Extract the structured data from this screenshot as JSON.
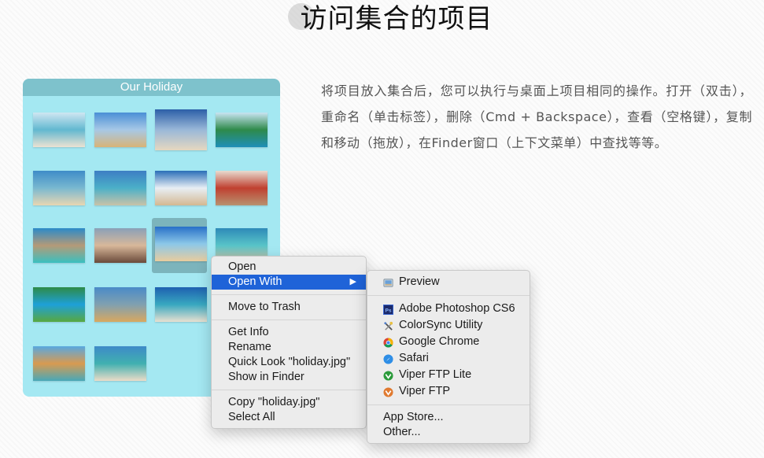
{
  "page": {
    "title": "访问集合的项目",
    "description": "将项目放入集合后，您可以执行与桌面上项目相同的操作。打开（双击），重命名（单击标签），删除（Cmd + Backspace），查看（空格键），复制和移动（拖放），在Finder窗口（上下文菜单）中查找等等。"
  },
  "collection": {
    "title": "Our Holiday",
    "selected_photo": "holiday.jpg",
    "photos": [
      {
        "name": "beach-chair-man",
        "colors": [
          "#cfe6f2",
          "#62b8d0",
          "#ece2d2"
        ]
      },
      {
        "name": "coconut-flipflops",
        "colors": [
          "#4a8fd6",
          "#a7c8e6",
          "#d8b478"
        ]
      },
      {
        "name": "friends-on-beach",
        "colors": [
          "#2b5fa8",
          "#9ab8d8",
          "#e6d8c0"
        ]
      },
      {
        "name": "green-island-bay",
        "colors": [
          "#c8e4f2",
          "#2e8a4a",
          "#1e8fb8"
        ]
      },
      {
        "name": "palm-beach-city",
        "colors": [
          "#3f8cc8",
          "#79b8d0",
          "#e8d6b2"
        ]
      },
      {
        "name": "coast-aerial",
        "colors": [
          "#3d7ec4",
          "#4bb0c8",
          "#c9c2a8"
        ]
      },
      {
        "name": "deck-chairs-beach",
        "colors": [
          "#2a6eb8",
          "#e8eef4",
          "#d4b892"
        ]
      },
      {
        "name": "woman-selfie-street",
        "colors": [
          "#e8dcd0",
          "#c04030",
          "#b89270"
        ]
      },
      {
        "name": "turquoise-bay",
        "colors": [
          "#2c8ac8",
          "#b49a78",
          "#3ac0c0"
        ]
      },
      {
        "name": "promenade-beach",
        "colors": [
          "#8aa0b8",
          "#d8b89a",
          "#6a4a3a"
        ]
      },
      {
        "name": "holiday.jpg",
        "colors": [
          "#2870c8",
          "#8cc8e8",
          "#e8cc9e"
        ]
      },
      {
        "name": "hammock-sea",
        "colors": [
          "#2e8ab8",
          "#58c4c8",
          "#d6c0a2"
        ]
      },
      {
        "name": "jungle-lagoon",
        "colors": [
          "#2e8a48",
          "#1ea0d8",
          "#58a840"
        ]
      },
      {
        "name": "sunbeds-pier",
        "colors": [
          "#4a8ac8",
          "#80a0b0",
          "#d8a860"
        ]
      },
      {
        "name": "umbrella-loungers",
        "colors": [
          "#1e60b0",
          "#38a8c0",
          "#e8e0d0"
        ]
      },
      {
        "name": "yellow-umbrella",
        "colors": [
          "#a8d0ec",
          "#dfe8f0",
          "#e8ecec"
        ]
      },
      {
        "name": "sandy-shore",
        "colors": [
          "#58a8e0",
          "#d89a50",
          "#48a8b8"
        ]
      },
      {
        "name": "man-jumping",
        "colors": [
          "#3e8ac8",
          "#40b0b0",
          "#ecdcc8"
        ]
      }
    ]
  },
  "context_menu": {
    "groups": [
      [
        {
          "label": "Open",
          "highlighted": false,
          "submenu": false
        },
        {
          "label": "Open With",
          "highlighted": true,
          "submenu": true,
          "arrow": "▶"
        }
      ],
      [
        {
          "label": "Move to Trash",
          "highlighted": false,
          "submenu": false
        }
      ],
      [
        {
          "label": "Get Info",
          "highlighted": false,
          "submenu": false
        },
        {
          "label": "Rename",
          "highlighted": false,
          "submenu": false
        },
        {
          "label": "Quick Look \"holiday.jpg\"",
          "highlighted": false,
          "submenu": false
        },
        {
          "label": "Show in Finder",
          "highlighted": false,
          "submenu": false
        }
      ],
      [
        {
          "label": "Copy \"holiday.jpg\"",
          "highlighted": false,
          "submenu": false
        },
        {
          "label": "Select All",
          "highlighted": false,
          "submenu": false
        }
      ]
    ]
  },
  "open_with_submenu": {
    "default_app": {
      "label": "Preview",
      "icon": "preview-icon"
    },
    "apps": [
      {
        "label": "Adobe Photoshop CS6",
        "icon": "photoshop-icon"
      },
      {
        "label": "ColorSync Utility",
        "icon": "colorsync-icon"
      },
      {
        "label": "Google Chrome",
        "icon": "chrome-icon"
      },
      {
        "label": "Safari",
        "icon": "safari-icon"
      },
      {
        "label": "Viper FTP Lite",
        "icon": "viper-ftp-lite-icon"
      },
      {
        "label": "Viper FTP",
        "icon": "viper-ftp-icon"
      }
    ],
    "footer": [
      {
        "label": "App Store..."
      },
      {
        "label": "Other..."
      }
    ]
  },
  "colors": {
    "highlight": "#1f63d8",
    "collection_bg": "#a4e8f2",
    "collection_header": "#7ec2cc"
  }
}
